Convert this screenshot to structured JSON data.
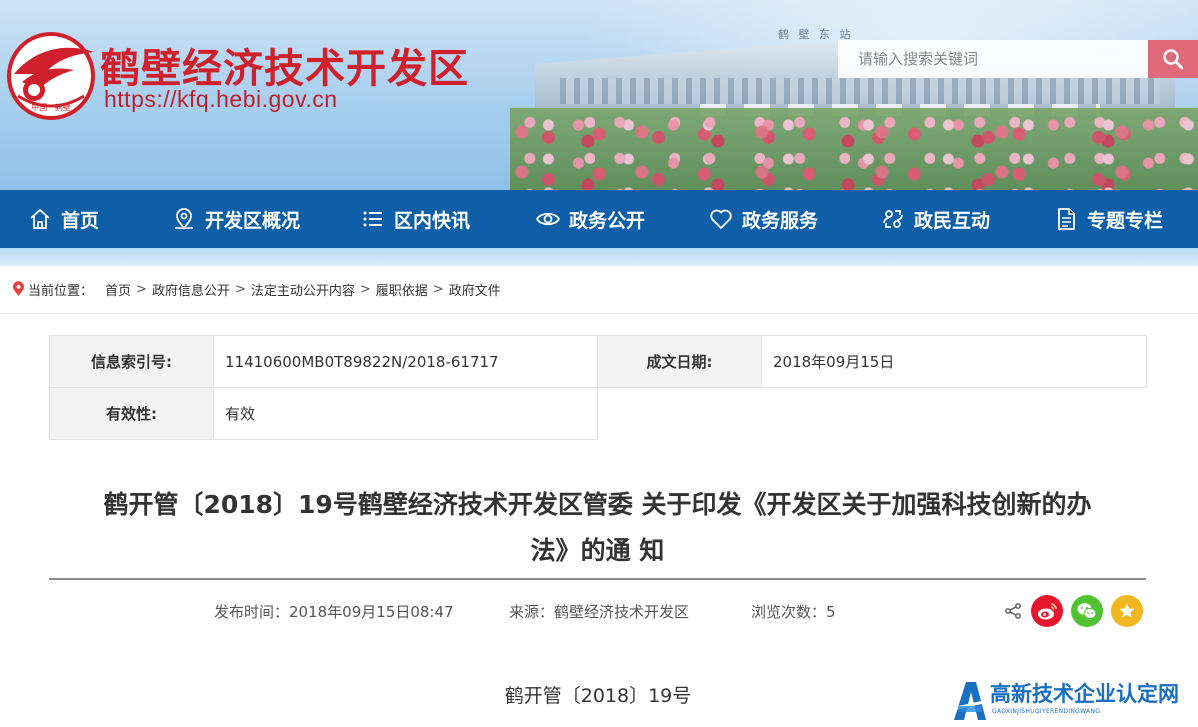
{
  "header": {
    "site_name": "鹤壁经济技术开发区",
    "site_url": "https://kfq.hebi.gov.cn",
    "logo_text": "中国 · 鹤壁",
    "banner_sign": "鹤 壁 东 站",
    "search_placeholder": "请输入搜索关键词",
    "search_icon": "search-icon"
  },
  "nav": {
    "items": [
      {
        "label": "首页",
        "icon": "home-icon"
      },
      {
        "label": "开发区概况",
        "icon": "map-pin-icon"
      },
      {
        "label": "区内快讯",
        "icon": "list-icon"
      },
      {
        "label": "政务公开",
        "icon": "eye-icon"
      },
      {
        "label": "政务服务",
        "icon": "heart-icon"
      },
      {
        "label": "政民互动",
        "icon": "interaction-icon"
      },
      {
        "label": "专题专栏",
        "icon": "document-icon"
      }
    ]
  },
  "breadcrumb": {
    "label": "当前位置：",
    "items": [
      "首页",
      "政府信息公开",
      "法定主动公开内容",
      "履职依据",
      "政府文件"
    ],
    "separator": ">"
  },
  "info": {
    "index_label": "信息索引号:",
    "index_value": "11410600MB0T89822N/2018-61717",
    "date_label": "成文日期:",
    "date_value": "2018年09月15日",
    "validity_label": "有效性:",
    "validity_value": "有效"
  },
  "article": {
    "title_line1": "鹤开管〔2018〕19号鹤壁经济技术开发区管委 关于印发《开发区关于加强科技创新的办",
    "title_line2": "法》的通 知",
    "publish_time": "发布时间：2018年09月15日08:47",
    "source": "来源：鹤壁经济技术开发区",
    "views": "浏览次数：5",
    "doc_number": "鹤开管〔2018〕19号"
  },
  "share": {
    "items": [
      {
        "name": "weibo",
        "icon": "weibo-icon",
        "color": "#e6162d"
      },
      {
        "name": "wechat",
        "icon": "wechat-icon",
        "color": "#51c332"
      },
      {
        "name": "favorite",
        "icon": "star-icon",
        "color": "#f2b61e"
      }
    ]
  },
  "watermark": {
    "title": "高新技术企业认定网",
    "subtitle": "GAOXINJISHUQIYERENDINGWANG"
  },
  "colors": {
    "nav_bg": "#0e5fa8",
    "brand_red": "#d0202c",
    "search_btn": "#e06a79"
  }
}
